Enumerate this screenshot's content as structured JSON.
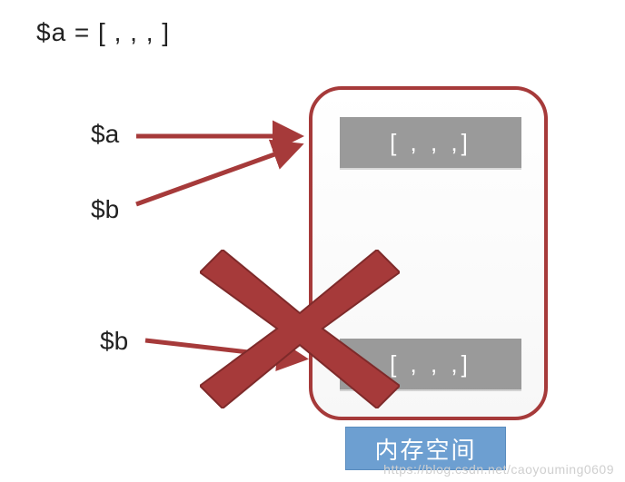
{
  "title_expression": "$a = [    ,  ,  ,   ]",
  "labels": {
    "a": "$a",
    "b_mid": "$b",
    "b_low": "$b"
  },
  "memory": {
    "caption": "内存空间",
    "slot_top": "[  ,  ,  ,]",
    "slot_bottom": "[  ,  ,  ,]"
  },
  "colors": {
    "accent_red": "#a63a3a",
    "slot_gray": "#9a9a9a",
    "caption_blue": "#6d9fd1"
  },
  "watermark": "https://blog.csdn.net/caoyouming0609"
}
